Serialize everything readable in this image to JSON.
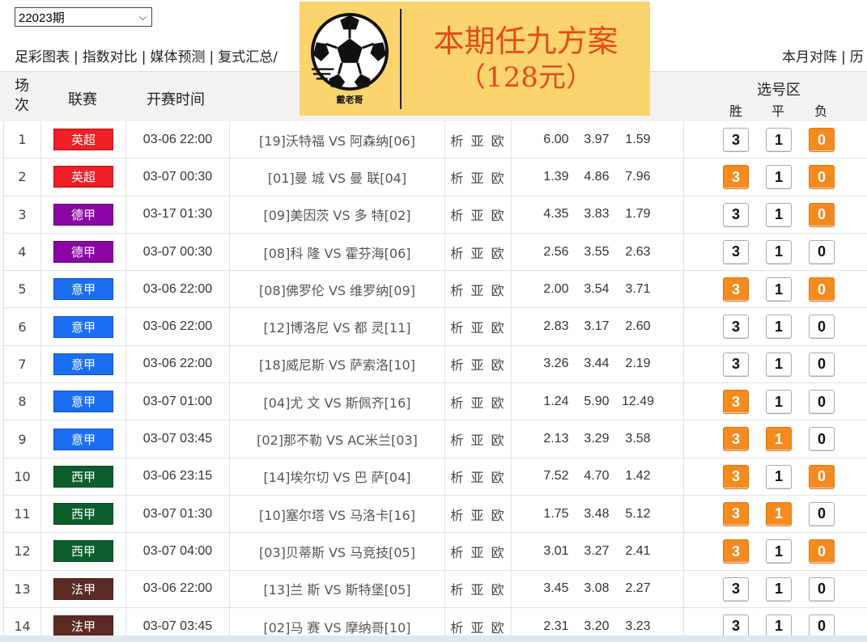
{
  "period_select": {
    "value": "22023期"
  },
  "nav_links": [
    "足彩图表",
    "指数对比",
    "媒体预测",
    "复式汇总/"
  ],
  "nav_right": [
    "本月对阵",
    "历"
  ],
  "banner": {
    "logo_text": "戴老哥",
    "title": "本期任九方案",
    "price": "（128元）"
  },
  "table_header": {
    "changci": "场次",
    "league": "联赛",
    "time": "开赛时间",
    "pick_area": "选号区",
    "win": "胜",
    "draw": "平",
    "lose": "负"
  },
  "league_colors": {
    "英超": "#ef1f25",
    "德甲": "#8a05a3",
    "意甲": "#1a6ef2",
    "西甲": "#0c5e2d",
    "法甲": "#5c2a24"
  },
  "xyo_label": "析 亚 欧",
  "matches": [
    {
      "num": "1",
      "league": "英超",
      "time": "03-06 22:00",
      "match": "[19]沃特福 VS 阿森纳[06]",
      "odds": [
        "6.00",
        "3.97",
        "1.59"
      ],
      "picks": {
        "3": false,
        "1": false,
        "0": true
      }
    },
    {
      "num": "2",
      "league": "英超",
      "time": "03-07 00:30",
      "match": "[01]曼 城 VS 曼 联[04]",
      "odds": [
        "1.39",
        "4.86",
        "7.96"
      ],
      "picks": {
        "3": true,
        "1": false,
        "0": true
      }
    },
    {
      "num": "3",
      "league": "德甲",
      "time": "03-17 01:30",
      "match": "[09]美因茨 VS 多 特[02]",
      "odds": [
        "4.35",
        "3.83",
        "1.79"
      ],
      "picks": {
        "3": false,
        "1": false,
        "0": true
      }
    },
    {
      "num": "4",
      "league": "德甲",
      "time": "03-07 00:30",
      "match": "[08]科 隆 VS 霍芬海[06]",
      "odds": [
        "2.56",
        "3.55",
        "2.63"
      ],
      "picks": {
        "3": false,
        "1": false,
        "0": false
      }
    },
    {
      "num": "5",
      "league": "意甲",
      "time": "03-06 22:00",
      "match": "[08]佛罗伦 VS 维罗纳[09]",
      "odds": [
        "2.00",
        "3.54",
        "3.71"
      ],
      "picks": {
        "3": true,
        "1": false,
        "0": true
      }
    },
    {
      "num": "6",
      "league": "意甲",
      "time": "03-06 22:00",
      "match": "[12]博洛尼 VS 都 灵[11]",
      "odds": [
        "2.83",
        "3.17",
        "2.60"
      ],
      "picks": {
        "3": false,
        "1": false,
        "0": false
      }
    },
    {
      "num": "7",
      "league": "意甲",
      "time": "03-06 22:00",
      "match": "[18]威尼斯 VS 萨索洛[10]",
      "odds": [
        "3.26",
        "3.44",
        "2.19"
      ],
      "picks": {
        "3": false,
        "1": false,
        "0": false
      }
    },
    {
      "num": "8",
      "league": "意甲",
      "time": "03-07 01:00",
      "match": "[04]尤 文 VS 斯佩齐[16]",
      "odds": [
        "1.24",
        "5.90",
        "12.49"
      ],
      "picks": {
        "3": true,
        "1": false,
        "0": false
      }
    },
    {
      "num": "9",
      "league": "意甲",
      "time": "03-07 03:45",
      "match": "[02]那不勒 VS AC米兰[03]",
      "odds": [
        "2.13",
        "3.29",
        "3.58"
      ],
      "picks": {
        "3": true,
        "1": true,
        "0": false
      }
    },
    {
      "num": "10",
      "league": "西甲",
      "time": "03-06 23:15",
      "match": "[14]埃尔切 VS 巴 萨[04]",
      "odds": [
        "7.52",
        "4.70",
        "1.42"
      ],
      "picks": {
        "3": true,
        "1": false,
        "0": true
      }
    },
    {
      "num": "11",
      "league": "西甲",
      "time": "03-07 01:30",
      "match": "[10]塞尔塔 VS 马洛卡[16]",
      "odds": [
        "1.75",
        "3.48",
        "5.12"
      ],
      "picks": {
        "3": true,
        "1": true,
        "0": false
      }
    },
    {
      "num": "12",
      "league": "西甲",
      "time": "03-07 04:00",
      "match": "[03]贝蒂斯 VS 马竞技[05]",
      "odds": [
        "3.01",
        "3.27",
        "2.41"
      ],
      "picks": {
        "3": true,
        "1": false,
        "0": true
      }
    },
    {
      "num": "13",
      "league": "法甲",
      "time": "03-06 22:00",
      "match": "[13]兰 斯 VS 斯特堡[05]",
      "odds": [
        "3.45",
        "3.08",
        "2.27"
      ],
      "picks": {
        "3": false,
        "1": false,
        "0": false
      }
    },
    {
      "num": "14",
      "league": "法甲",
      "time": "03-07 03:45",
      "match": "[02]马 赛 VS 摩纳哥[10]",
      "odds": [
        "2.31",
        "3.20",
        "3.23"
      ],
      "picks": {
        "3": false,
        "1": false,
        "0": false
      }
    }
  ],
  "pick_labels": [
    "3",
    "1",
    "0"
  ]
}
